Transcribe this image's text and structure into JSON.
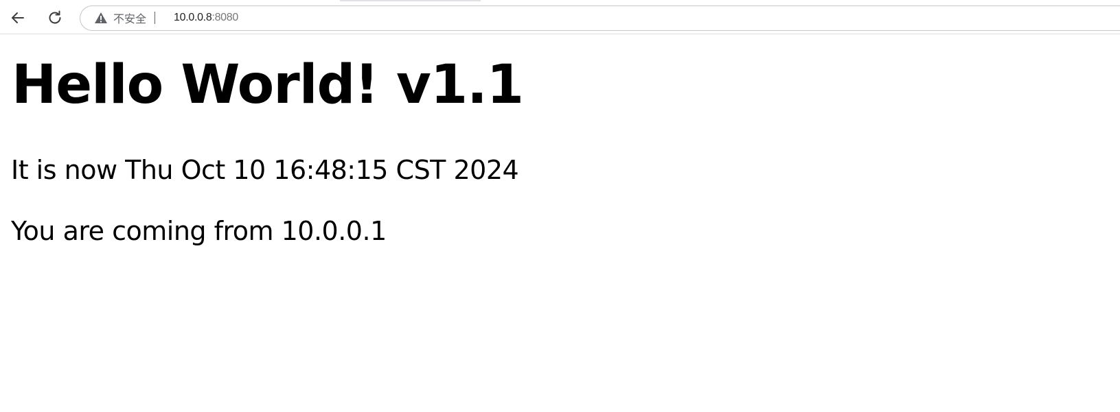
{
  "browser": {
    "security_label": "不安全",
    "url_host": "10.0.0.8",
    "url_port": ":8080"
  },
  "icons": {
    "back": "back-arrow-icon",
    "reload": "reload-icon",
    "warning": "warning-triangle-icon"
  },
  "page": {
    "heading": "Hello World! v1.1",
    "time_text": "It is now Thu Oct 10 16:48:15 CST 2024",
    "source_text": "You are coming from 10.0.0.1"
  }
}
